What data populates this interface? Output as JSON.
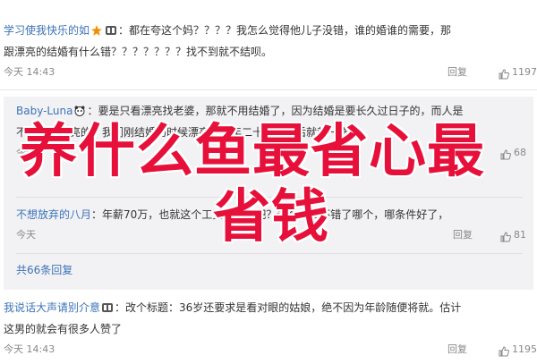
{
  "comments": [
    {
      "user": "学习使我快乐的如",
      "text": "：都在夸这个妈？？？？我怎么觉得他儿子没错，谁的婚谁的需要，那",
      "text2": "跟漂亮的结婚有什么错？？？？？？？找不到就不结呗。",
      "time": "今天 14:43",
      "reply": "回复",
      "likes": "1197"
    },
    {
      "user": "我说话大声请别介意",
      "text": "：改个标题：36岁还要求是看对眼的姑娘，绝不因为年龄随便将就。估计",
      "text2": "这男的就会有很多人赞了",
      "time": "今天 14:43",
      "reply": "回复",
      "likes": "1195"
    }
  ],
  "subs": [
    {
      "user": "Baby-Luna",
      "text": "：要是只看漂亮找老婆，那就不用结婚了，因为结婚是要长久过日子的，而人是",
      "text2": "不会一直漂亮的，我们刚结婚的时候漂亮，十年二十年过去后就都一样了。",
      "time": "今天",
      "reply": "回复",
      "likes": "68"
    },
    {
      "user": "不想放弃的八月",
      "text": "：年薪70万，也就这个工资也不低吧？这个工资不错了哪个，哪条件好了，",
      "time": "今天",
      "reply": "回复",
      "likes": "81"
    }
  ],
  "more_replies": "共66条回复",
  "overlay": {
    "line1": "养什么鱼最省心最",
    "line2": "省钱"
  },
  "colors": {
    "username": "#3c73b8",
    "overlay_red": "#e6103a",
    "sub_bg": "#f2f2f5"
  }
}
